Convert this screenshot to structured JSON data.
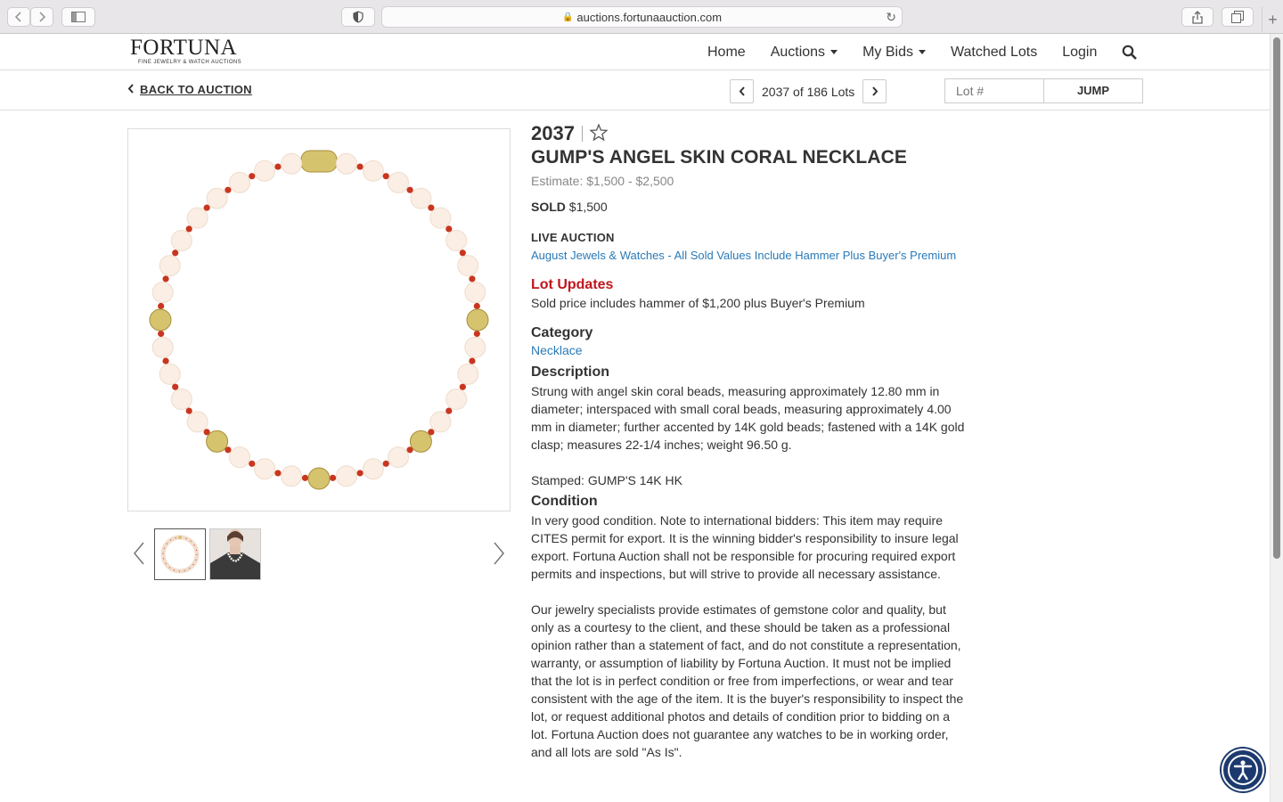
{
  "browser": {
    "url": "auctions.fortunaauction.com"
  },
  "header": {
    "logo_main": "FORTUNA",
    "logo_sub": "FINE JEWELRY & WATCH AUCTIONS",
    "nav": {
      "home": "Home",
      "auctions": "Auctions",
      "my_bids": "My Bids",
      "watched_lots": "Watched Lots",
      "login": "Login"
    }
  },
  "subbar": {
    "back_label": "BACK TO AUCTION",
    "pager_text": "2037 of 186 Lots",
    "lot_placeholder": "Lot #",
    "jump_label": "JUMP"
  },
  "lot": {
    "number": "2037",
    "title": "GUMP'S ANGEL SKIN CORAL NECKLACE",
    "estimate": "Estimate: $1,500 - $2,500",
    "sold_label": "SOLD",
    "sold_price": "$1,500",
    "live_label": "LIVE AUCTION",
    "auction_name": "August Jewels & Watches - All Sold Values Include Hammer Plus Buyer's Premium",
    "updates_title": "Lot Updates",
    "updates_text": "Sold price includes hammer of $1,200 plus Buyer's Premium",
    "category_title": "Category",
    "category": "Necklace",
    "description_title": "Description",
    "description": "Strung with angel skin coral beads, measuring approximately 12.80 mm in diameter; interspaced with small coral beads, measuring approximately 4.00 mm in diameter; further accented by 14K gold beads; fastened with a 14K gold clasp; measures 22-1/4 inches; weight 96.50 g.",
    "stamped": "Stamped: GUMP'S 14K HK",
    "condition_title": "Condition",
    "condition": "In very good condition. Note to international bidders: This item may require CITES permit for export. It is the winning bidder's responsibility to insure legal export. Fortuna Auction shall not be responsible for procuring required export permits and inspections, but will strive to provide all necessary assistance.",
    "disclaimer": "Our jewelry specialists provide estimates of gemstone color and quality, but only as a courtesy to the client, and these should be taken as a professional opinion rather than a statement of fact, and do not constitute a representation, warranty, or assumption of liability by Fortuna Auction. It must not be implied that the lot is in perfect condition or free from imperfections, or wear and tear consistent with the age of the item. It is the buyer's responsibility to inspect the lot, or request additional photos and details of condition prior to bidding on a lot. Fortuna Auction does not guarantee any watches to be in working order, and all lots are sold \"As Is\"."
  },
  "colors": {
    "link_blue": "#2a7ab8",
    "updates_red": "#c0161d",
    "coral_white": "#fbeee4",
    "coral_red": "#c9361f",
    "gold": "#d6c36e",
    "a11y_blue": "#1c3a6e"
  },
  "icons": {
    "back": "chevron-left-icon",
    "prev": "chevron-left-icon",
    "next": "chevron-right-icon",
    "search": "search-icon",
    "watch": "star-outline-icon",
    "accessibility": "accessibility-icon"
  }
}
